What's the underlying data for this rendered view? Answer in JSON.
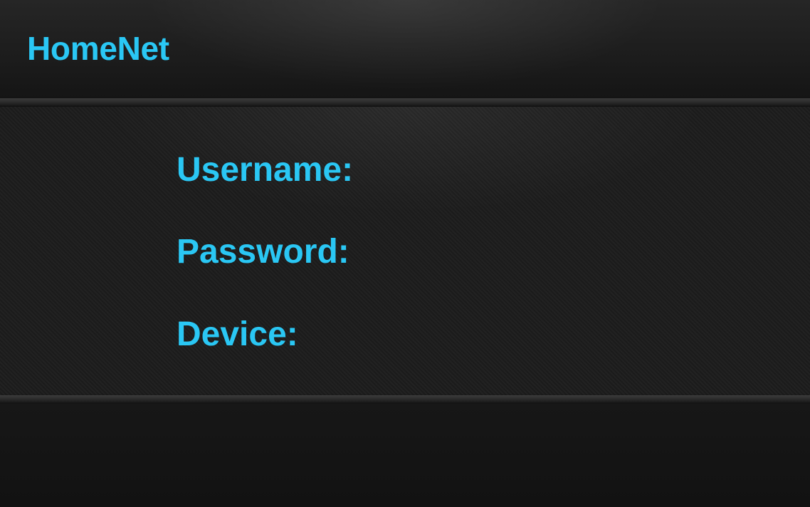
{
  "header": {
    "brand": "HomeNet"
  },
  "form": {
    "username_label": "Username:",
    "password_label": "Password:",
    "device_label": "Device:"
  },
  "colors": {
    "accent": "#2ac7f4",
    "background": "#141414"
  }
}
